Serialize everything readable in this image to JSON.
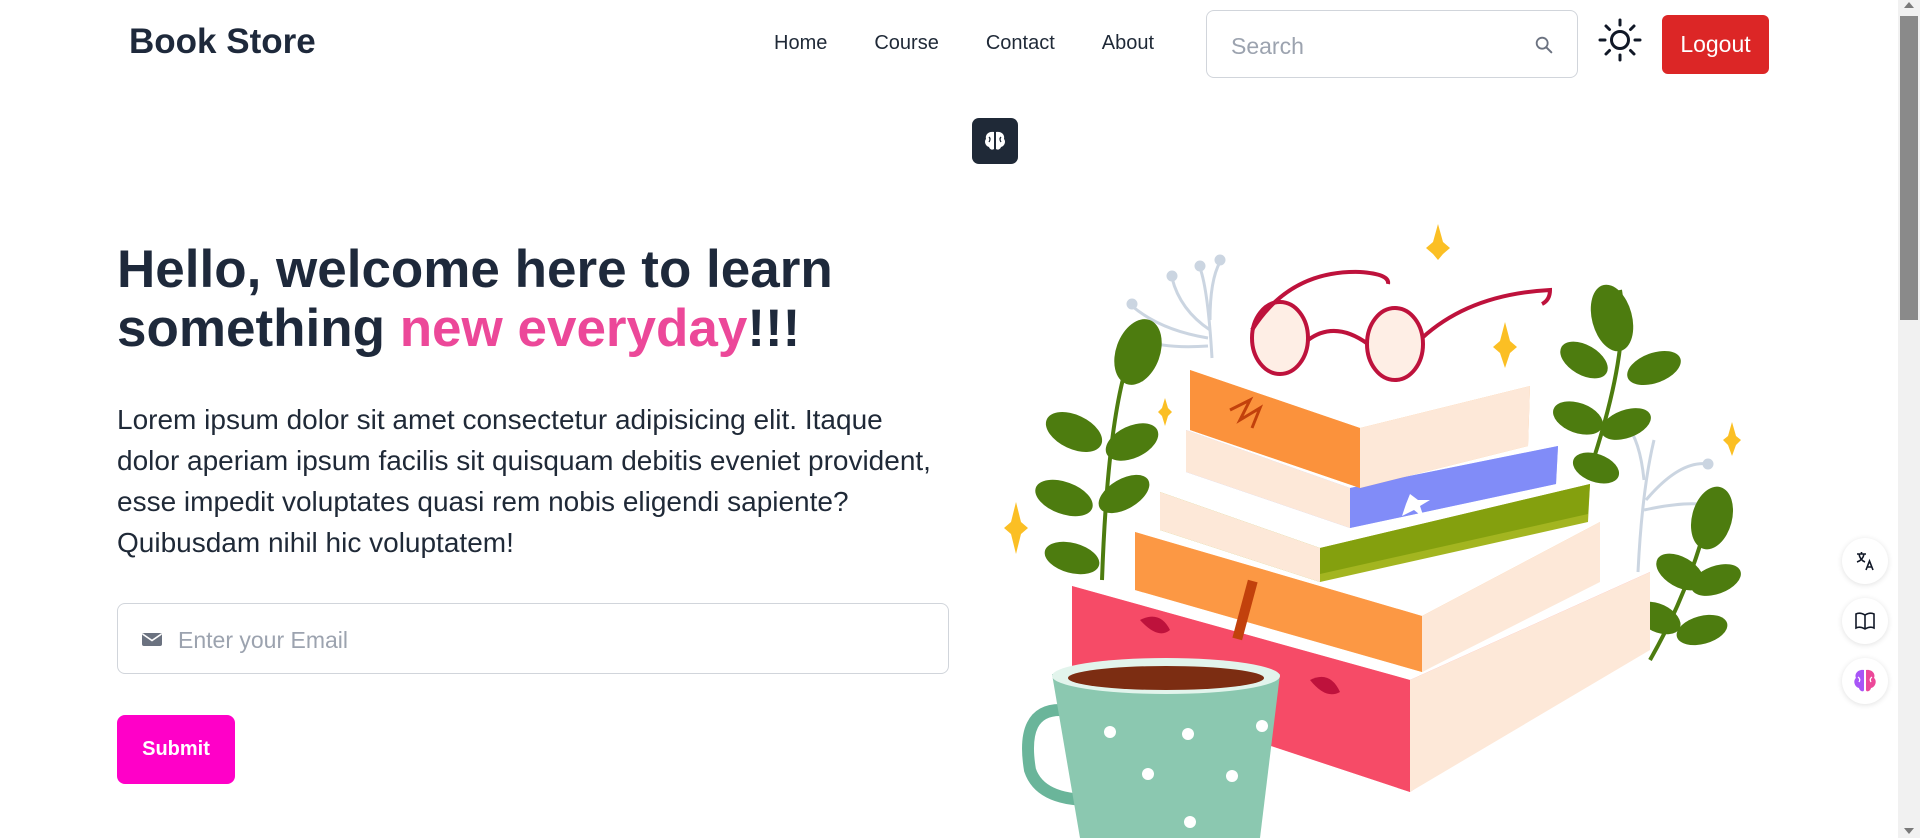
{
  "navbar": {
    "brand": "Book Store",
    "links": [
      "Home",
      "Course",
      "Contact",
      "About"
    ],
    "search_placeholder": "Search",
    "logout_label": "Logout"
  },
  "hero": {
    "title_part1": "Hello, welcome here to learn something ",
    "title_highlight": "new everyday",
    "title_part2": "!!!",
    "paragraph": "Lorem ipsum dolor sit amet consectetur adipisicing elit. Itaque dolor aperiam ipsum facilis sit quisquam debitis eveniet provident, esse impedit voluptates quasi rem nobis eligendi sapiente? Quibusdam nihil hic voluptatem!",
    "email_placeholder": "Enter your Email",
    "submit_label": "Submit"
  },
  "icons": {
    "search": "search-icon",
    "theme": "sun-icon",
    "email": "envelope-icon",
    "brain_badge": "brain-icon",
    "side_tools": [
      "translate-icon",
      "book-open-icon",
      "brain-colorful-icon"
    ]
  },
  "colors": {
    "logout": "#dc2626",
    "highlight": "#ec4899",
    "submit": "#ff00c8",
    "title": "#1e293b"
  }
}
